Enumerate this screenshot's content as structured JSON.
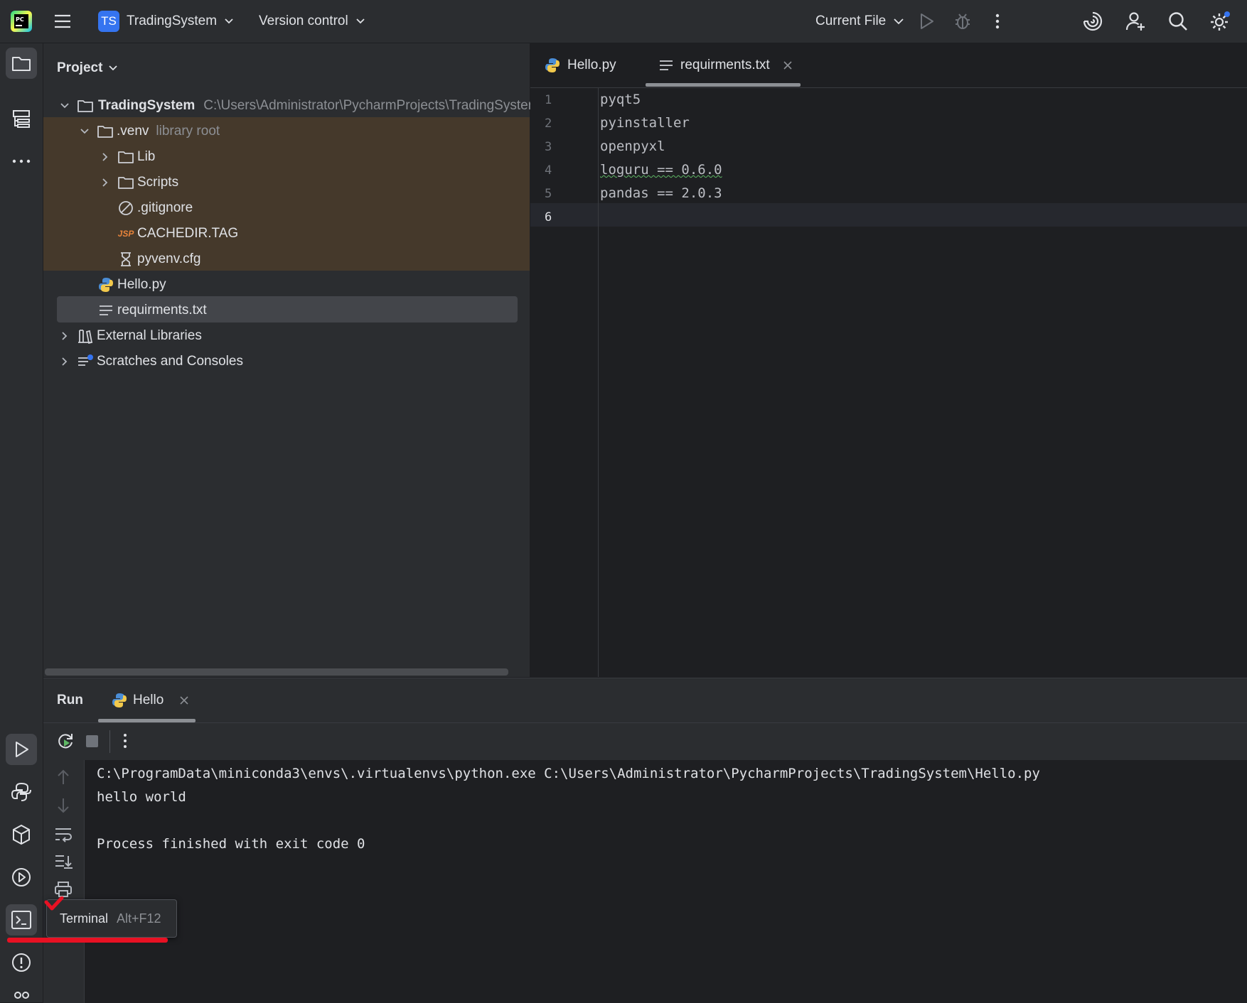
{
  "titlebar": {
    "project_badge": "TS",
    "project_name": "TradingSystem",
    "vcs": "Version control",
    "run_config": "Current File"
  },
  "project_panel": {
    "title": "Project",
    "tree": {
      "root_name": "TradingSystem",
      "root_path": "C:\\Users\\Administrator\\PycharmProjects\\TradingSystem",
      "venv_name": ".venv",
      "venv_hint": "library root",
      "lib": "Lib",
      "scripts": "Scripts",
      "gitignore": ".gitignore",
      "cachedir": "CACHEDIR.TAG",
      "cachedir_badge": "JSP",
      "pyvenv": "pyvenv.cfg",
      "hello": "Hello.py",
      "requirements": "requirments.txt",
      "external": "External Libraries",
      "scratches": "Scratches and Consoles"
    }
  },
  "editor": {
    "tabs": [
      {
        "label": "Hello.py",
        "active": false
      },
      {
        "label": "requirments.txt",
        "active": true
      }
    ],
    "line_numbers": [
      "1",
      "2",
      "3",
      "4",
      "5",
      "6"
    ],
    "lines": [
      "pyqt5",
      "pyinstaller",
      "openpyxl",
      "loguru == 0.6.0",
      "pandas == 2.0.3",
      ""
    ]
  },
  "run_panel": {
    "title": "Run",
    "tab_label": "Hello",
    "output": [
      "C:\\ProgramData\\miniconda3\\envs\\.virtualenvs\\python.exe C:\\Users\\Administrator\\PycharmProjects\\TradingSystem\\Hello.py",
      "hello world",
      "",
      "Process finished with exit code 0"
    ]
  },
  "tooltip": {
    "label": "Terminal",
    "shortcut": "Alt+F12"
  },
  "colors": {
    "accent": "#3574f0",
    "annotation": "#e81123",
    "venv_highlight": "#45392b",
    "run_green": "#5fb865"
  }
}
